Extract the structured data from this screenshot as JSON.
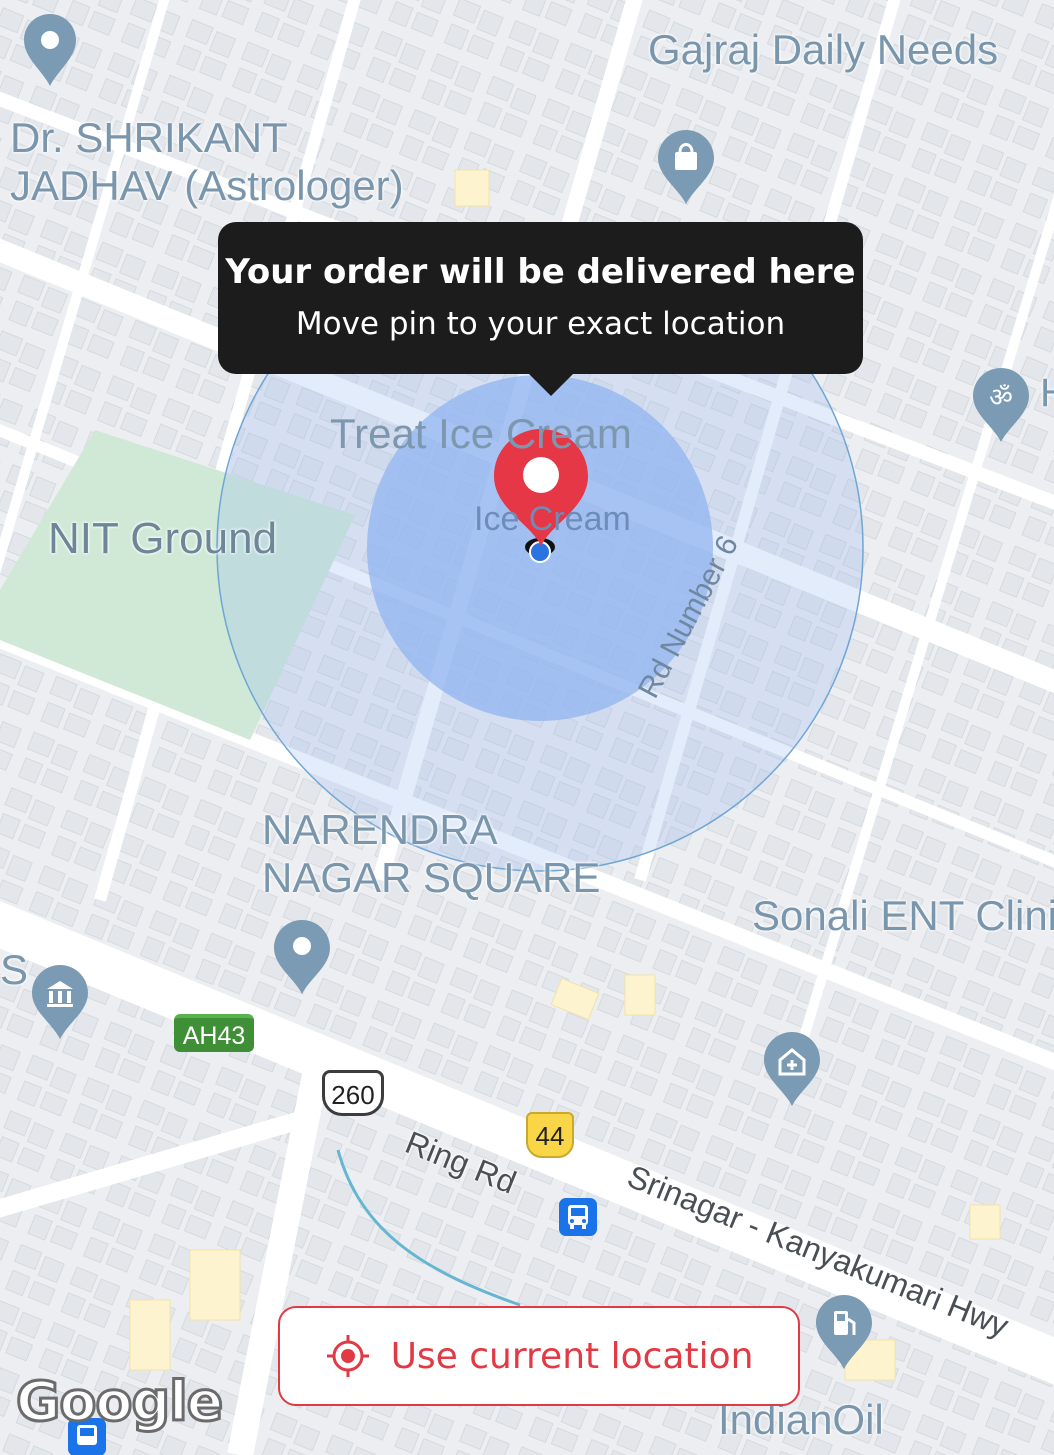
{
  "map": {
    "places": {
      "gajraj": "Gajraj Daily Needs",
      "astrologer_line1": "Dr. SHRIKANT",
      "astrologer_line2": "JADHAV (Astrologer)",
      "nit_ground": "NIT Ground",
      "treat_ice_cream": "Treat Ice Cream",
      "ice_cream_small": "Ice Cream",
      "narendra_line1": "NARENDRA",
      "narendra_line2": "NAGAR SQUARE",
      "sonali": "Sonali ENT Clinic",
      "indianoil": "IndianOil",
      "temple_partial": "H",
      "left_partial": "S"
    },
    "roads": {
      "rd6": "Rd Number 6",
      "ring_rd": "Ring Rd",
      "hwy": "Srinagar - Kanyakumari Hwy"
    },
    "shields": {
      "ah43": "AH43",
      "us260": "260",
      "nh44": "44"
    },
    "attribution": "Google",
    "colors": {
      "accuracy_circle": "#9bbcf2",
      "pin": "#e53746",
      "poi_pin": "#7a9bb3",
      "park": "#cfe9d6"
    }
  },
  "tooltip": {
    "title": "Your order will be delivered here",
    "subtitle": "Move pin to your exact location"
  },
  "current_location_button": {
    "label": "Use current location",
    "icon": "gps-target-icon"
  }
}
